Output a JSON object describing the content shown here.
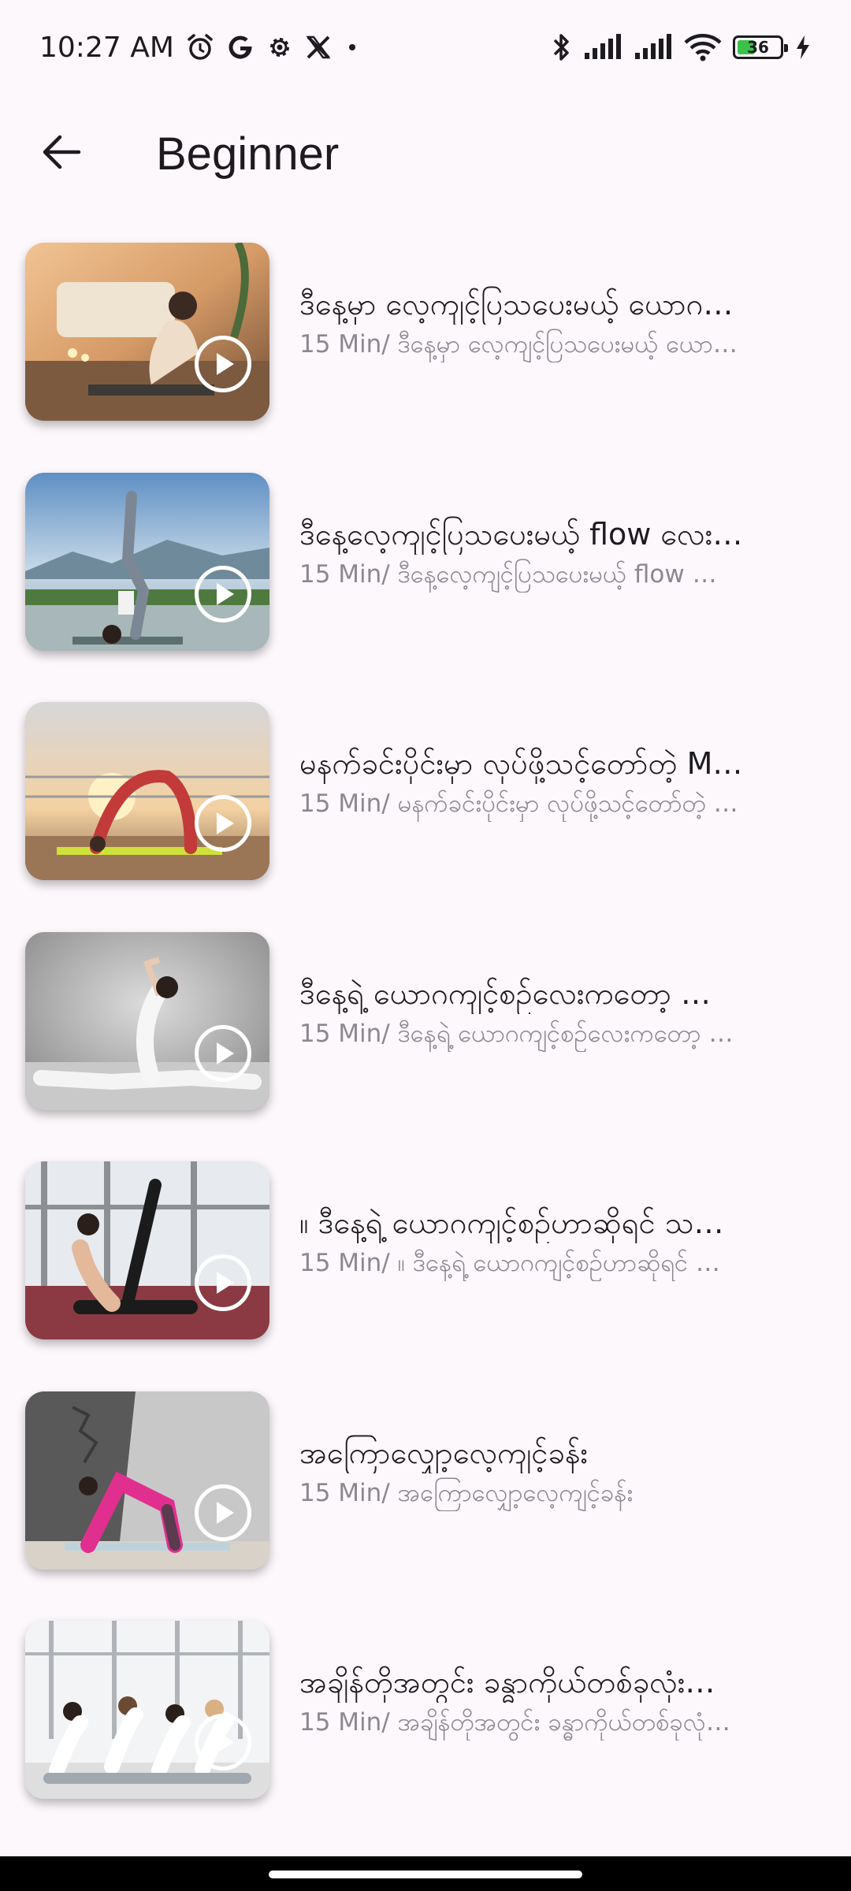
{
  "status_bar": {
    "time": "10:27 AM",
    "battery": "36",
    "icons_left": [
      "alarm-icon",
      "google-icon",
      "settings-icon",
      "x-icon",
      "dot-icon"
    ],
    "icons_right": [
      "bluetooth-icon",
      "signal-icon",
      "signal-icon",
      "wifi-icon",
      "battery-icon",
      "charging-icon"
    ]
  },
  "app_bar": {
    "back_icon": "arrow-left-icon",
    "title": "Beginner"
  },
  "videos": [
    {
      "title": "ဒီနေ့မှာ လေ့ကျင့်ပြသပေးမယ့် ယောဂ…",
      "subtitle": "15 Min/ ဒီနေ့မှာ လေ့ကျင့်ပြသပေးမယ့် ယော…"
    },
    {
      "title": "ဒီနေ့လေ့ကျင့်ပြသပေးမယ့် flow လေး…",
      "subtitle": "15 Min/ ဒီနေ့လေ့ကျင့်ပြသပေးမယ့် flow …"
    },
    {
      "title": "မနက်ခင်းပိုင်းမှာ လုပ်ဖို့သင့်တော်တဲ့ M…",
      "subtitle": "15 Min/ မနက်ခင်းပိုင်းမှာ လုပ်ဖို့သင့်တော်တဲ့ …"
    },
    {
      "title": "ဒီနေ့ရဲ့ ယောဂကျင့်စဉ်လေးကတော့ …",
      "subtitle": "15 Min/ ဒီနေ့ရဲ့ ယောဂကျင့်စဉ်လေးကတော့ …"
    },
    {
      "title": "။ ဒီနေ့ရဲ့ ယောဂကျင့်စဉ်ဟာဆိုရင် သ…",
      "subtitle": "15 Min/ ။ ဒီနေ့ရဲ့ ယောဂကျင့်စဉ်ဟာဆိုရင် …"
    },
    {
      "title": "အကြောလျှော့လေ့ကျင့်ခန်း",
      "subtitle": "15 Min/ အကြောလျှော့လေ့ကျင့်ခန်း"
    },
    {
      "title": "အချိန်တိုအတွင်း ခန္ဓာကိုယ်တစ်ခုလုံး…",
      "subtitle": "15 Min/ အချိန်တိုအတွင်း ခန္ဓာကိုယ်တစ်ခုလုံ…"
    }
  ],
  "colors": {
    "background": "#fdf8fc",
    "text": "#1d1b20",
    "subtext": "#8c8892",
    "battery": "#3ac34a"
  }
}
